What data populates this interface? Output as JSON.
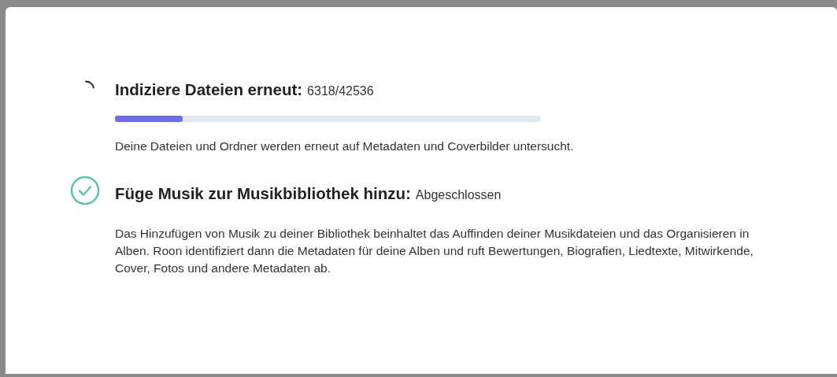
{
  "steps": [
    {
      "kind": "in_progress",
      "title": "Indiziere Dateien erneut:",
      "status": "6318/42536",
      "level": 0.16,
      "description": "Deine Dateien und Ordner werden erneut auf Metadaten und Coverbilder untersucht."
    },
    {
      "kind": "done",
      "title": "Füge Musik zur Musikbibliothek hinzu:",
      "status": "Abgeschlossen",
      "description": "Das Hinzufügen von Musik zu deiner Bibliothek beinhaltet das Auffinden deiner Musikdateien und das Organisieren in Alben. Roon identifiziert dann die Metadaten für deine Alben und ruft Bewertungen, Biografien, Liedtexte, Mitwirkende, Cover, Fotos und andere Metadaten ab."
    }
  ]
}
